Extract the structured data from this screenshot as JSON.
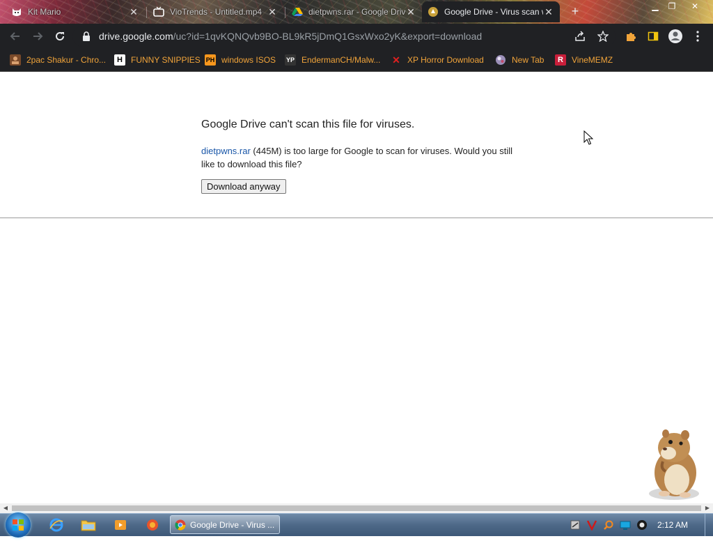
{
  "browser": {
    "tabs": [
      {
        "title": "Kit Mario",
        "icon": "cat-icon",
        "active": false
      },
      {
        "title": "VioTrends - Untitled.mp4",
        "icon": "tv-icon",
        "active": false
      },
      {
        "title": "dietpwns.rar - Google Drive",
        "icon": "drive-icon",
        "active": false
      },
      {
        "title": "Google Drive - Virus scan warning",
        "icon": "drive-warning-icon",
        "active": true
      }
    ],
    "new_tab_label": "+",
    "address": {
      "host": "drive.google.com",
      "path": "/uc?id=1qvKQNQvb9BO-BL9kR5jDmQ1GsxWxo2yK&export=download"
    },
    "bookmarks": [
      {
        "label": "2pac Shakur - Chro...",
        "icon": "2pac-icon"
      },
      {
        "label": "FUNNY SNIPPIES",
        "icon": "h-icon"
      },
      {
        "label": "windows ISOS",
        "icon": "ph-icon"
      },
      {
        "label": "EndermanCH/Malw...",
        "icon": "yp-icon"
      },
      {
        "label": "XP Horror Download",
        "icon": "x-icon"
      },
      {
        "label": "New Tab",
        "icon": "globe-icon"
      },
      {
        "label": "VineMEMZ",
        "icon": "r-icon"
      }
    ]
  },
  "page": {
    "heading": "Google Drive can't scan this file for viruses.",
    "file_name": "dietpwns.rar",
    "message_rest": " (445M) is too large for Google to scan for viruses. Would you still like to download this file?",
    "download_button": "Download anyway"
  },
  "taskbar": {
    "active_task": "Google Drive - Virus ...",
    "clock": "2:12 AM"
  },
  "colors": {
    "chrome_dark": "#202124",
    "bookmark_text": "#f1a43a",
    "link": "#1a57a8"
  }
}
